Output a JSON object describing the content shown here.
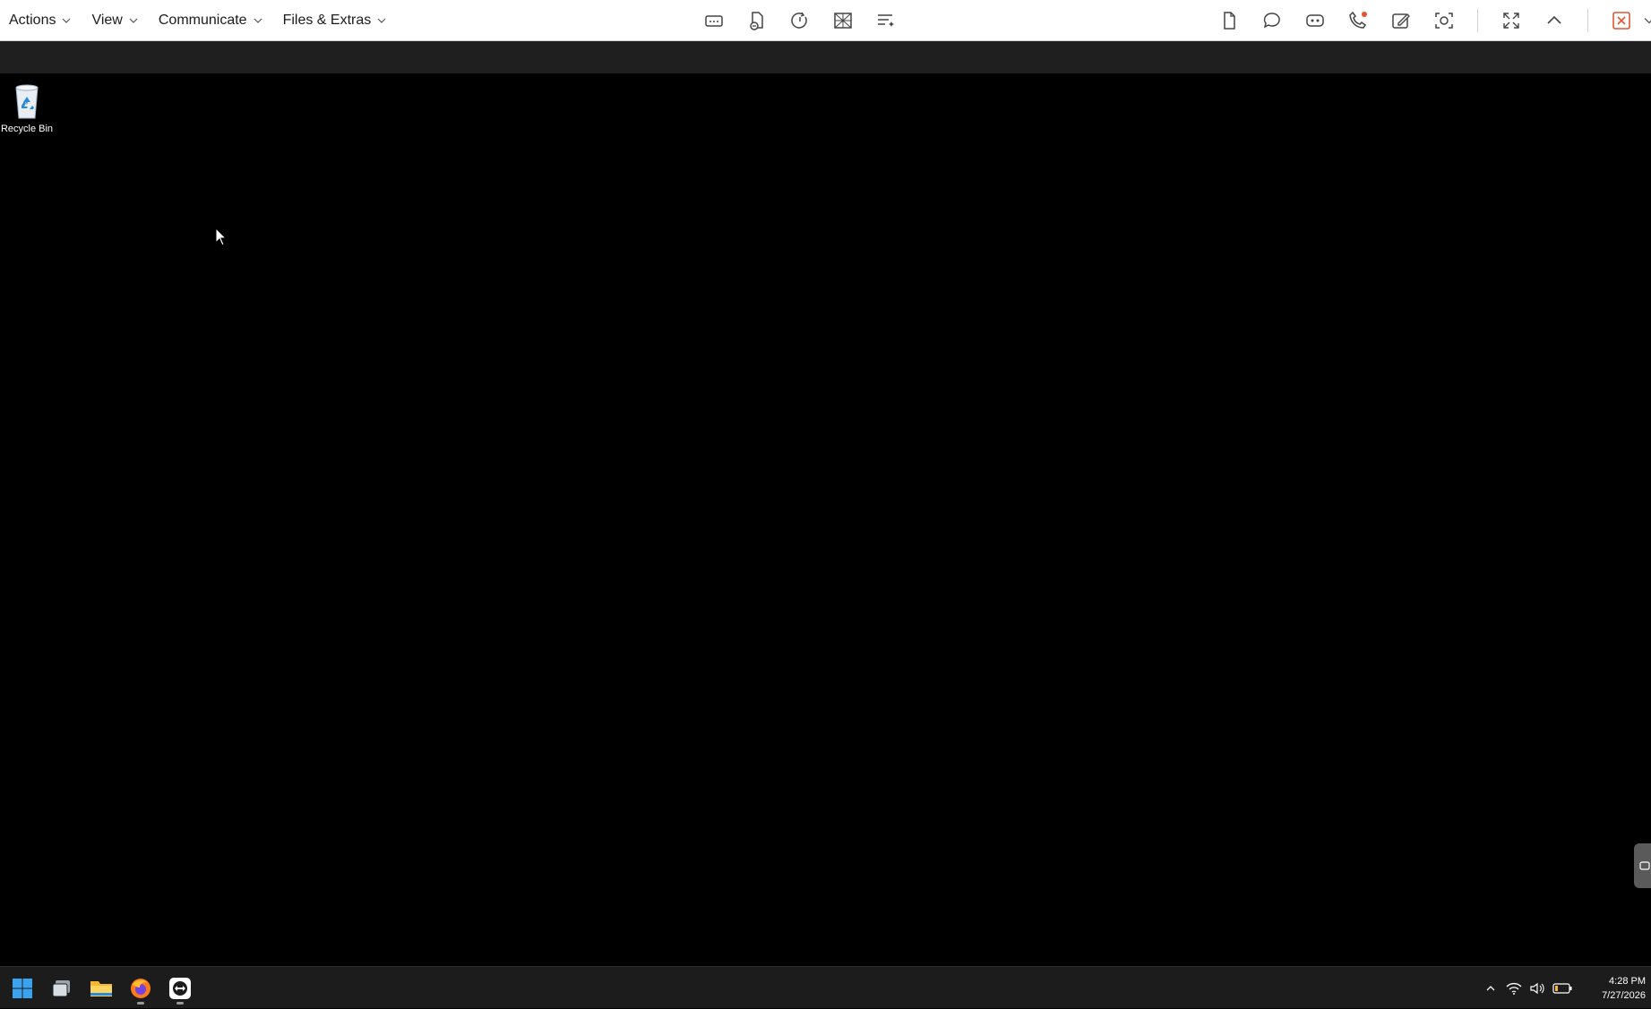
{
  "toolbar": {
    "menus": [
      {
        "label": "Actions"
      },
      {
        "label": "View"
      },
      {
        "label": "Communicate"
      },
      {
        "label": "Files & Extras"
      }
    ],
    "center_icons": [
      "remote-keyboard-icon",
      "file-transfer-icon",
      "restart-icon",
      "disable-remote-input-icon",
      "annotation-icon"
    ],
    "right_icons": [
      "file-share-icon",
      "chat-icon",
      "video-icon",
      "call-icon",
      "whiteboard-icon",
      "screenshot-icon",
      "fullscreen-icon",
      "collapse-toolbar-icon",
      "end-session-icon",
      "more-options-icon"
    ],
    "accent_color": "#e2552e"
  },
  "desktop": {
    "recycle_bin_label": "Recycle Bin",
    "background_color": "#000000"
  },
  "taskbar": {
    "apps": [
      "windows-start-icon",
      "task-view-icon",
      "file-explorer-icon",
      "firefox-icon",
      "teamviewer-icon"
    ],
    "tray_icons": [
      "chevron-up-icon",
      "wifi-icon",
      "volume-icon",
      "battery-icon"
    ],
    "time": "4:28 PM",
    "date": "7/27/2026"
  }
}
